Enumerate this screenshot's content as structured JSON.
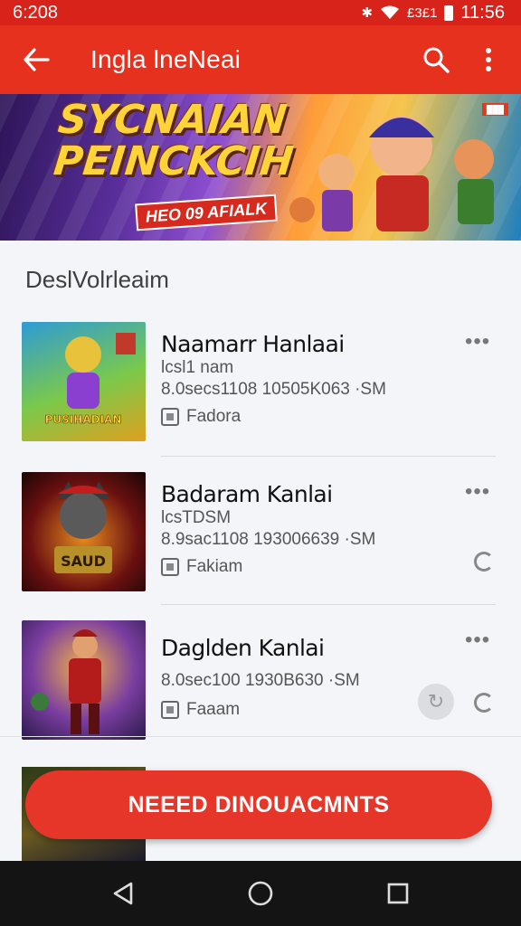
{
  "status": {
    "time": "6:208",
    "right_text": "£3£1",
    "clock": "11:56"
  },
  "app_bar": {
    "title": "Ingla lneNeai"
  },
  "banner": {
    "title_line1": "SYCNAIAN",
    "title_line2": "PEINCKCIH",
    "ribbon": "HEO 09 AFIALK"
  },
  "section": {
    "title": "DeslVolrleaim"
  },
  "games": [
    {
      "title": "Naamarr Hanlaai",
      "subtitle": "lcsl1 nam",
      "meta": "8.0secs1108  10505K063 ·SM",
      "tag": "Fadora",
      "thumb_text": "PUSIHADIAN"
    },
    {
      "title": "Badaram Kanlai",
      "subtitle": "lcsTDSM",
      "meta": "8.9sac1108  193006639 ·SM",
      "tag": "Fakiam",
      "thumb_text": "SAUD"
    },
    {
      "title": "Daglden Kanlai",
      "subtitle": "",
      "meta": "8.0sec100  1930B630 ·SM",
      "tag": "Faaam",
      "thumb_text": ""
    }
  ],
  "cta": {
    "label": "NEEED DINOUACMNTS"
  },
  "colors": {
    "primary": "#e6311f",
    "status_bar": "#d8231b",
    "cta": "#e6362a",
    "nav_bar": "#141414"
  }
}
